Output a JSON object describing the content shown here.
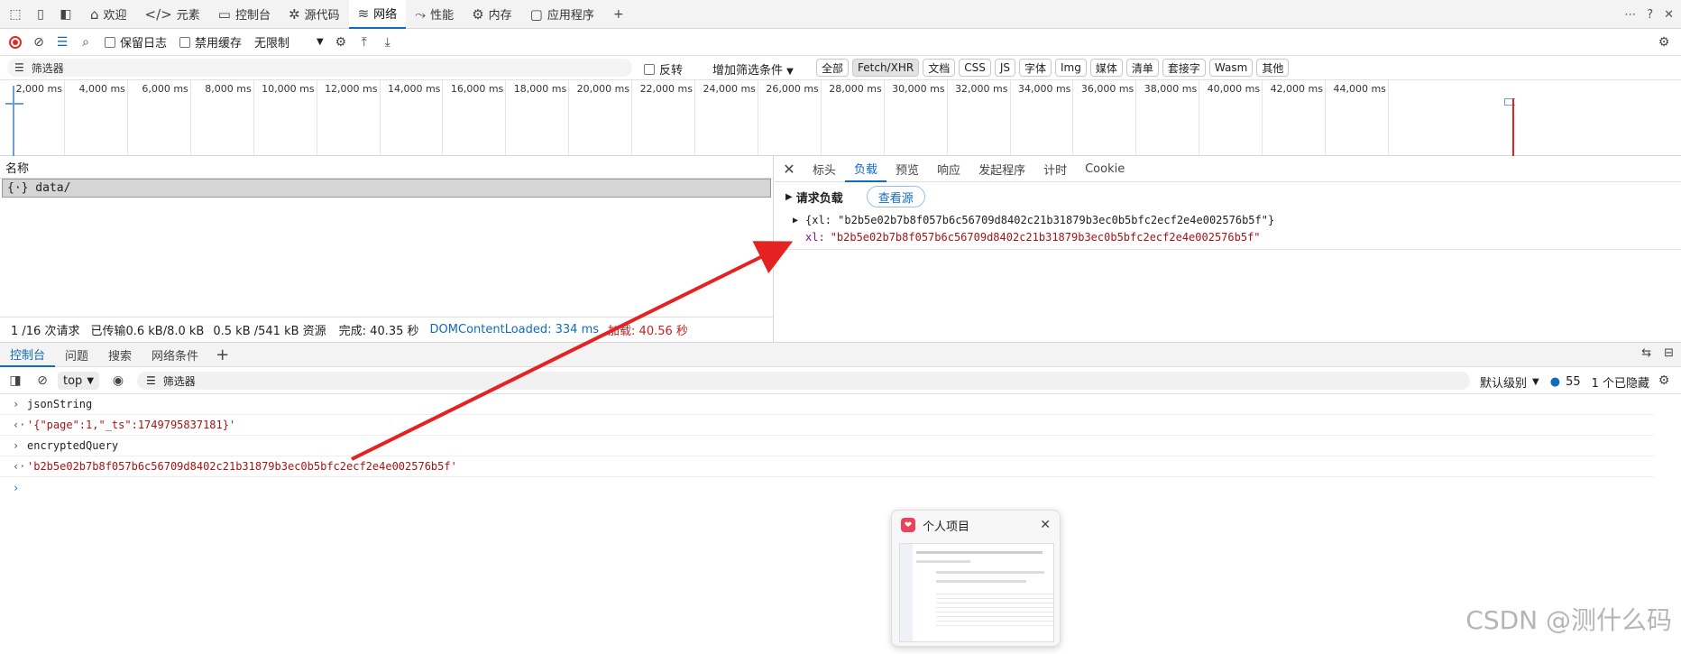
{
  "tabbar": {
    "tabs": [
      {
        "icon": "home-icon",
        "glyph": "⌂",
        "label": "欢迎"
      },
      {
        "icon": "elements-icon",
        "glyph": "</>",
        "label": "元素"
      },
      {
        "icon": "console-icon",
        "glyph": "▭",
        "label": "控制台"
      },
      {
        "icon": "sources-icon",
        "glyph": "✲",
        "label": "源代码"
      },
      {
        "icon": "network-icon",
        "glyph": "≋",
        "label": "网络"
      },
      {
        "icon": "performance-icon",
        "glyph": "⤳",
        "label": "性能"
      },
      {
        "icon": "memory-icon",
        "glyph": "⚙",
        "label": "内存"
      },
      {
        "icon": "application-icon",
        "glyph": "▢",
        "label": "应用程序"
      }
    ],
    "active_tab": "网络"
  },
  "network_toolbar": {
    "preserve_log": "保留日志",
    "disable_cache": "禁用缓存",
    "throttle": "无限制"
  },
  "filter_row": {
    "placeholder": "筛选器",
    "invert": "反转",
    "more_filters": "增加筛选条件",
    "types": [
      "全部",
      "Fetch/XHR",
      "文档",
      "CSS",
      "JS",
      "字体",
      "Img",
      "媒体",
      "清单",
      "套接字",
      "Wasm",
      "其他"
    ],
    "active_type": "Fetch/XHR"
  },
  "timeline": {
    "ticks": [
      "2,000 ms",
      "4,000 ms",
      "6,000 ms",
      "8,000 ms",
      "10,000 ms",
      "12,000 ms",
      "14,000 ms",
      "16,000 ms",
      "18,000 ms",
      "20,000 ms",
      "22,000 ms",
      "24,000 ms",
      "26,000 ms",
      "28,000 ms",
      "30,000 ms",
      "32,000 ms",
      "34,000 ms",
      "36,000 ms",
      "38,000 ms",
      "40,000 ms",
      "42,000 ms",
      "44,000 ms"
    ]
  },
  "request_list": {
    "header": "名称",
    "selected_request": "{·} data/",
    "status": {
      "requests": "1 /16 次请求",
      "transferred": "已传输0.6 kB/8.0 kB",
      "resources": "0.5 kB /541 kB 资源",
      "finish": "完成: 40.35 秒",
      "dom_loaded": "DOMContentLoaded: 334 ms",
      "load": "加载: 40.56 秒"
    }
  },
  "detail": {
    "tabs": [
      "标头",
      "负载",
      "预览",
      "响应",
      "发起程序",
      "计时",
      "Cookie"
    ],
    "active_tab": "负载",
    "section_title": "请求负载",
    "view_source": "查看源",
    "payload_summary": "{xl: \"b2b5e02b7b8f057b6c56709d8402c21b31879b3ec0b5bfc2ecf2e4e002576b5f\"}",
    "payload_key": "xl:",
    "payload_value": "\"b2b5e02b7b8f057b6c56709d8402c21b31879b3ec0b5bfc2ecf2e4e002576b5f\""
  },
  "drawer": {
    "tabs": [
      "控制台",
      "问题",
      "搜索",
      "网络条件"
    ],
    "active_tab": "控制台"
  },
  "console_toolbar": {
    "context": "top",
    "filter_placeholder": "筛选器",
    "levels": "默认级别",
    "issue_count": "55",
    "hidden": "1 个已隐藏"
  },
  "console": {
    "lines": [
      {
        "arrow": "›",
        "text": "jsonString",
        "kind": "input"
      },
      {
        "arrow": "‹·",
        "text": "'{\"page\":1,\"_ts\":1749795837181}'",
        "kind": "output"
      },
      {
        "arrow": "›",
        "text": "encryptedQuery",
        "kind": "input"
      },
      {
        "arrow": "‹·",
        "text": "'b2b5e02b7b8f057b6c56709d8402c21b31879b3ec0b5bfc2ecf2e4e002576b5f'",
        "kind": "output"
      }
    ],
    "prompt": "›"
  },
  "popup": {
    "title": "个人项目"
  },
  "watermark": "CSDN @测什么码",
  "colors": {
    "accent": "#0f6cbd",
    "string": "#a31515",
    "annotation_arrow": "#e52222"
  }
}
